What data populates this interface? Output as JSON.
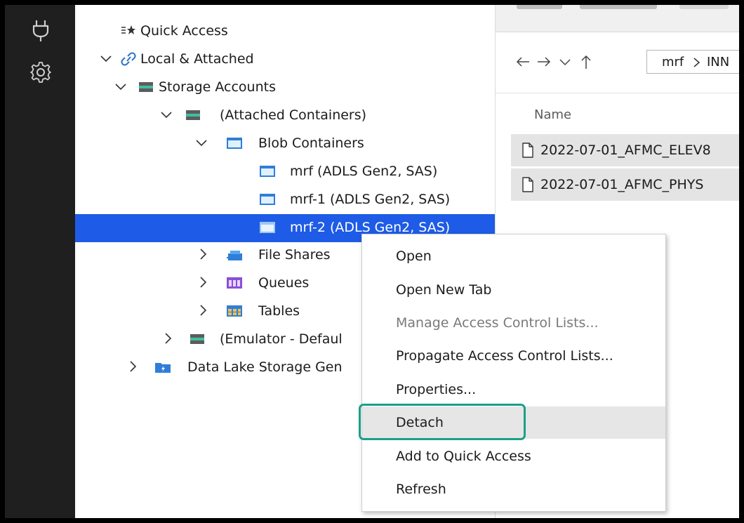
{
  "activity_bar": {
    "icons": [
      "plug-icon",
      "gear-icon"
    ]
  },
  "tree": {
    "quick_access": {
      "label": "Quick Access",
      "icon": "quick-access-icon"
    },
    "local_attached": {
      "label": "Local & Attached",
      "icon": "link-icon"
    },
    "storage_accounts": {
      "label": "Storage Accounts",
      "icon": "storage-account-icon"
    },
    "attached_containers": {
      "label": "(Attached Containers)",
      "icon": "storage-account-icon"
    },
    "blob_containers": {
      "label": "Blob Containers",
      "icon": "blob-container-icon"
    },
    "mrf": {
      "label": "mrf (ADLS Gen2, SAS)",
      "icon": "blob-container-icon"
    },
    "mrf_1": {
      "label": "mrf-1 (ADLS Gen2, SAS)",
      "icon": "blob-container-icon"
    },
    "mrf_2": {
      "label": "mrf-2 (ADLS Gen2, SAS)",
      "icon": "blob-container-icon",
      "selected": true
    },
    "file_shares": {
      "label": "File Shares",
      "icon": "file-share-icon"
    },
    "queues": {
      "label": "Queues",
      "icon": "queue-icon"
    },
    "tables": {
      "label": "Tables",
      "icon": "table-icon"
    },
    "emulator": {
      "label": "(Emulator - Defaul",
      "icon": "storage-account-icon"
    },
    "data_lake": {
      "label": "Data Lake Storage Gen",
      "icon": "data-lake-icon"
    }
  },
  "main": {
    "path_root": "mrf",
    "path_next": "INN",
    "column_header": "Name",
    "files": [
      {
        "name": "2022-07-01_AFMC_ELEV8"
      },
      {
        "name": "2022-07-01_AFMC_PHYS"
      }
    ]
  },
  "context_menu": {
    "items": [
      {
        "label": "Open",
        "disabled": false
      },
      {
        "label": "Open New Tab",
        "disabled": false
      },
      {
        "label": "Manage Access Control Lists...",
        "disabled": true
      },
      {
        "label": "Propagate Access Control Lists...",
        "disabled": false
      },
      {
        "label": "Properties...",
        "disabled": false
      },
      {
        "label": "Detach",
        "disabled": false,
        "hovered": true
      },
      {
        "label": "Add to Quick Access",
        "disabled": false
      },
      {
        "label": "Refresh",
        "disabled": false
      }
    ]
  },
  "colors": {
    "selection": "#1e5be6",
    "highlight": "#1aa08a",
    "activity_bar": "#1f1f1f"
  }
}
